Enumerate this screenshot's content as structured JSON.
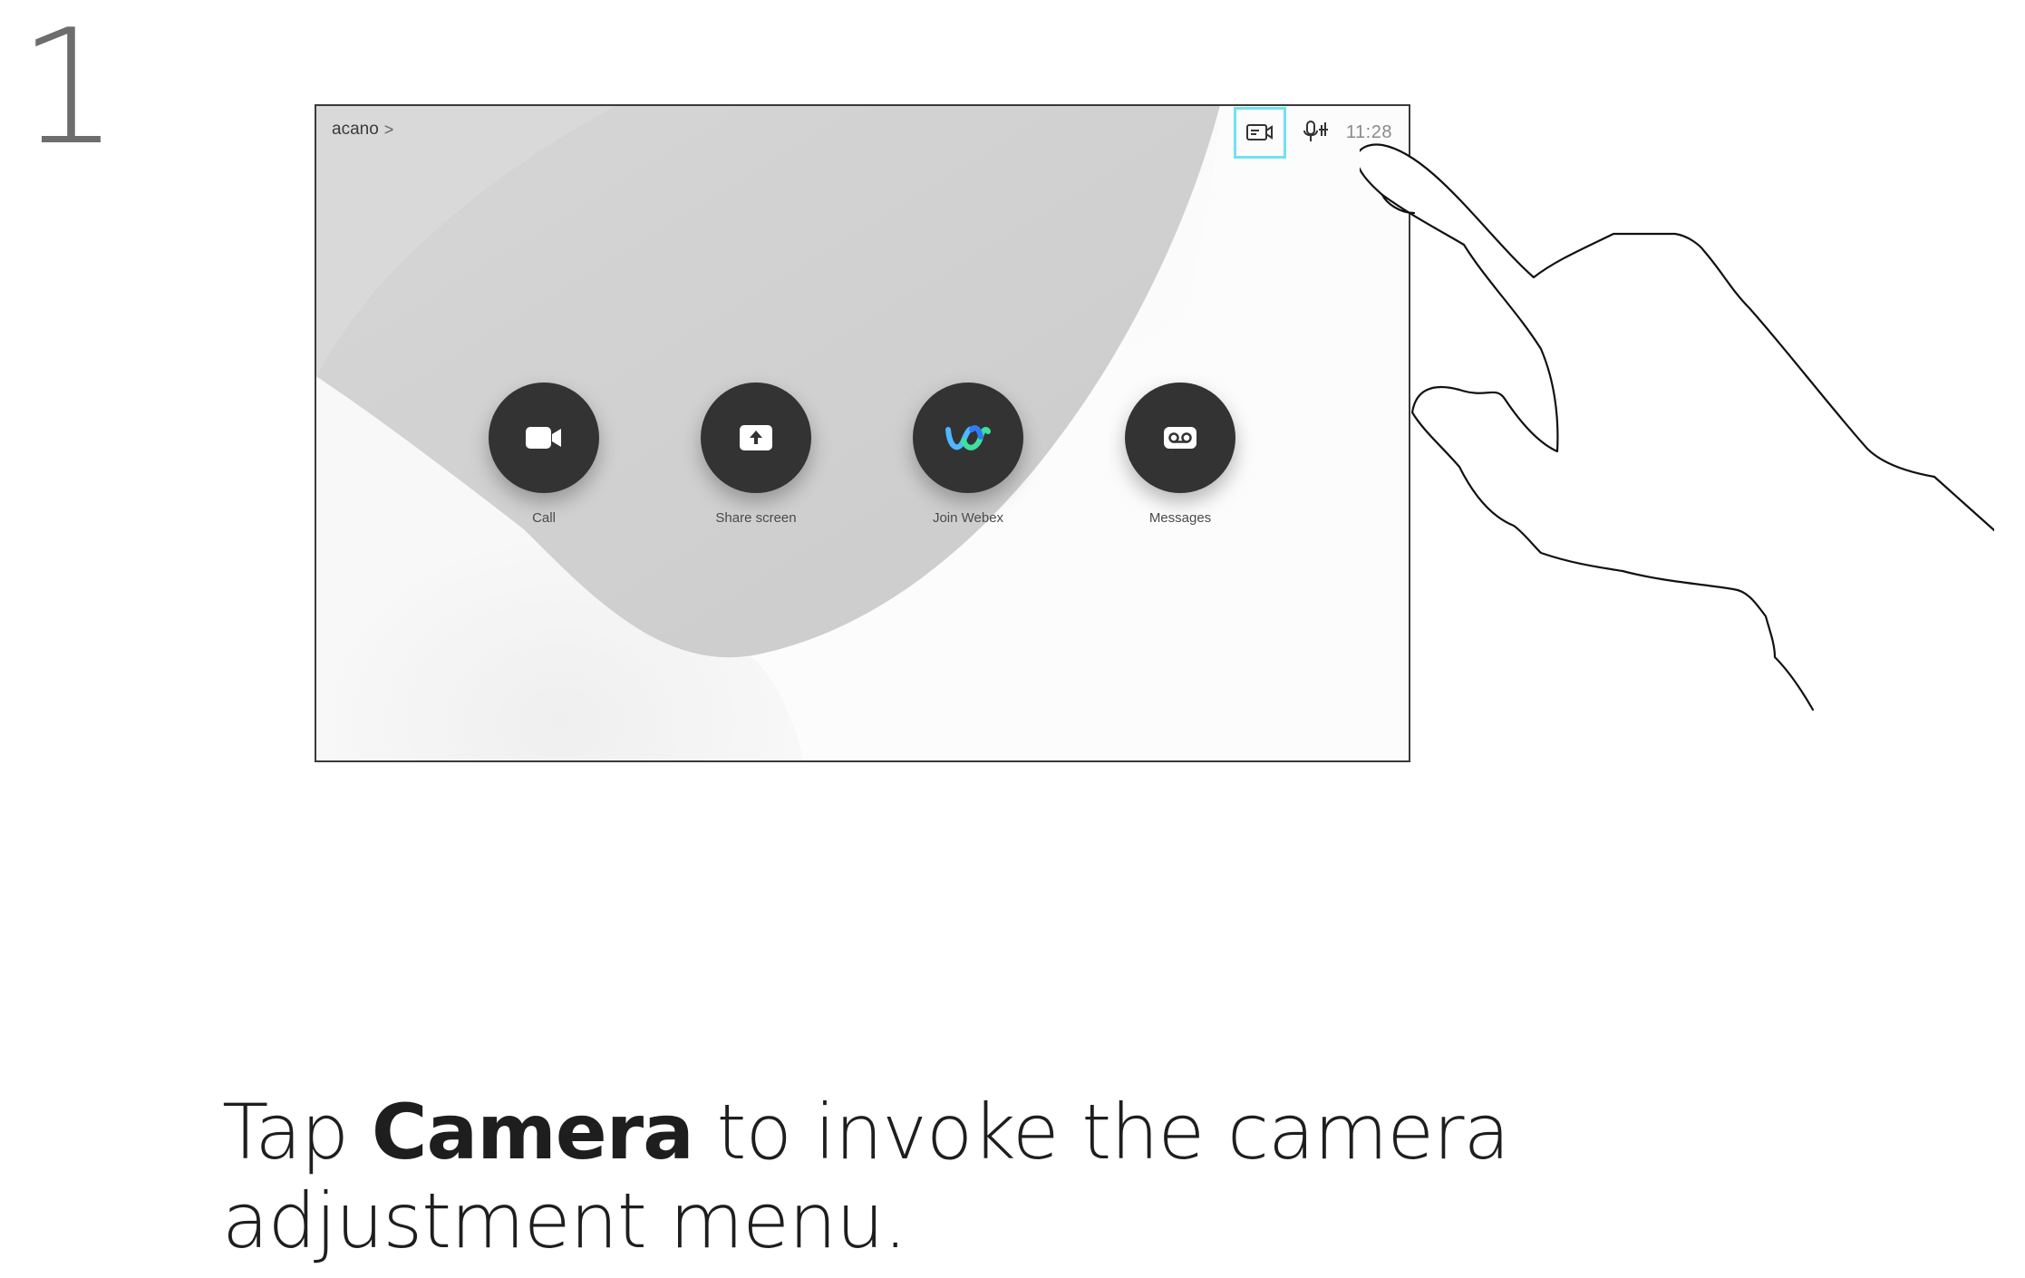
{
  "step": {
    "number": "1"
  },
  "device": {
    "name": "acano",
    "name_chevron": ">",
    "clock": "11:28",
    "status_icons": [
      "camera-icon",
      "microphone-icon"
    ],
    "highlight_color": "#6fe3ee",
    "actions": [
      {
        "label": "Call",
        "icon": "video-camera-icon"
      },
      {
        "label": "Share screen",
        "icon": "share-upload-icon"
      },
      {
        "label": "Join Webex",
        "icon": "webex-logo-icon"
      },
      {
        "label": "Messages",
        "icon": "voicemail-icon"
      }
    ]
  },
  "instruction": {
    "prefix": "Tap ",
    "bold": "Camera",
    "suffix": " to invoke the camera",
    "line2": "adjustment menu."
  }
}
